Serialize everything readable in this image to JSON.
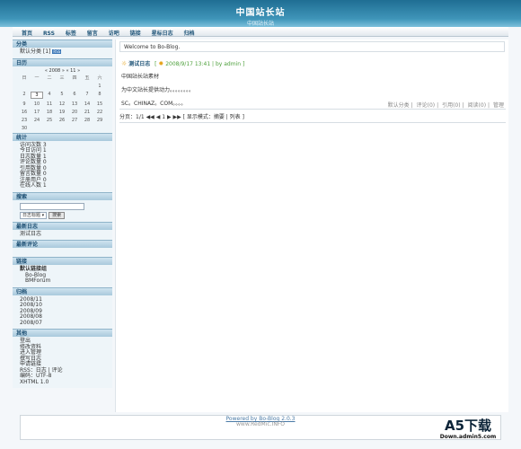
{
  "header": {
    "title": "中国站长站",
    "subtitle": "中国站长站"
  },
  "nav": [
    "首页",
    "RSS",
    "标签",
    "留言",
    "访吧",
    "链接",
    "星标日志",
    "归档"
  ],
  "sidebar": {
    "category": {
      "title": "分类",
      "item": "默认分类 [1]",
      "badge": "RSS"
    },
    "calendar": {
      "title": "日历",
      "header": "« 2008 »  « 11 »",
      "weekdays": [
        "日",
        "一",
        "二",
        "三",
        "四",
        "五",
        "六"
      ],
      "today": "3",
      "days": [
        "",
        "",
        "",
        "",
        "",
        "",
        "1",
        "2",
        "3",
        "4",
        "5",
        "6",
        "7",
        "8",
        "9",
        "10",
        "11",
        "12",
        "13",
        "14",
        "15",
        "16",
        "17",
        "18",
        "19",
        "20",
        "21",
        "22",
        "23",
        "24",
        "25",
        "26",
        "27",
        "28",
        "29",
        "30"
      ]
    },
    "stats": {
      "title": "统计",
      "items": [
        "访问次数 3",
        "今日访问 1",
        "日志数量 1",
        "评论数量 0",
        "引用数量 0",
        "留言数量 0",
        "注册用户 0",
        "在线人数 1"
      ]
    },
    "search": {
      "title": "搜索",
      "select": "日志标题",
      "button": "搜索"
    },
    "recent": {
      "title": "最新日志",
      "items": [
        "测试日志"
      ]
    },
    "comments": {
      "title": "最新评论"
    },
    "links": {
      "title": "链接",
      "items": [
        "默认链接组",
        "Bo-Blog",
        "BMForum"
      ]
    },
    "archive": {
      "title": "归档",
      "items": [
        "2008/11",
        "2008/10",
        "2008/09",
        "2008/08",
        "2008/07"
      ]
    },
    "misc": {
      "title": "其他",
      "items": [
        "登出",
        "修改资料",
        "进入管理",
        "撰写日志",
        "申请链接",
        "RSS：日志 | 评论",
        "编码：UTF-8",
        "XHTML 1.0"
      ]
    }
  },
  "main": {
    "welcome": "Welcome to Bo-Blog.",
    "post": {
      "title": "测试日志",
      "meta": "2008/9/17 13:41 | by admin",
      "lines": [
        "中国站长站素材",
        "为中文站长提供动力。。。。。。。。",
        "SC。CHINAZ。COM。。。。"
      ],
      "footer": [
        "默认分类",
        "评论(0)",
        "引用(0)",
        "阅读(0)",
        "管理"
      ]
    },
    "pager": "分页：1/1 ◀◀ ◀ 1 ▶ ▶▶ [ 显示模式：摘要 | 列表 ]"
  },
  "footer": {
    "line1": "Powered by Bo-Blog 2.0.3",
    "line2": "www.RedMic.INFO"
  },
  "watermark": {
    "logo": "A5下载",
    "url": "Down.admin5.com"
  }
}
